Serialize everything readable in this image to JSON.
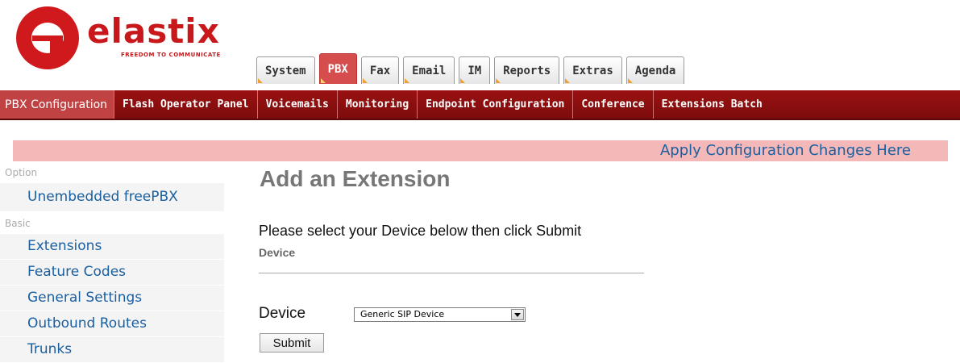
{
  "logo": {
    "word": "elastix",
    "tagline": "FREEDOM TO COMMUNICATE"
  },
  "tabs": [
    {
      "label": "System"
    },
    {
      "label": "PBX"
    },
    {
      "label": "Fax"
    },
    {
      "label": "Email"
    },
    {
      "label": "IM"
    },
    {
      "label": "Reports"
    },
    {
      "label": "Extras"
    },
    {
      "label": "Agenda"
    }
  ],
  "subnav": [
    {
      "label": "PBX Configuration"
    },
    {
      "label": "Flash Operator Panel"
    },
    {
      "label": "Voicemails"
    },
    {
      "label": "Monitoring"
    },
    {
      "label": "Endpoint Configuration"
    },
    {
      "label": "Conference"
    },
    {
      "label": "Extensions Batch"
    }
  ],
  "apply_link": "Apply Configuration Changes Here",
  "sidebar": {
    "option_header": "Option",
    "unembedded": "Unembedded freePBX",
    "basic_header": "Basic",
    "items": [
      {
        "label": "Extensions"
      },
      {
        "label": "Feature Codes"
      },
      {
        "label": "General Settings"
      },
      {
        "label": "Outbound Routes"
      },
      {
        "label": "Trunks"
      }
    ]
  },
  "main": {
    "title": "Add an Extension",
    "instruction": "Please select your Device below then click Submit",
    "section_label": "Device",
    "device_label": "Device",
    "device_selected": "Generic SIP Device",
    "submit_label": "Submit"
  },
  "colors": {
    "brand_red": "#c8181b",
    "subnav_bg": "#8a0f0f",
    "apply_bar": "#f5b8b8",
    "link_blue": "#1a5fa0"
  }
}
